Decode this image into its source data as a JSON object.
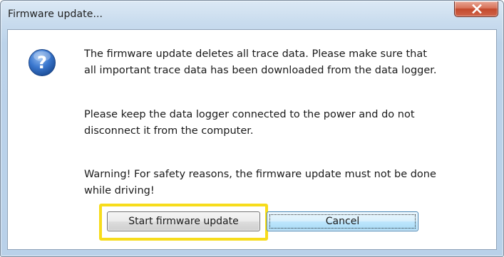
{
  "window": {
    "title": "Firmware update...",
    "close_icon": "close-x-icon"
  },
  "dialog": {
    "icon": "question-icon",
    "paragraphs": [
      {
        "lines": [
          "The firmware update deletes all trace data. Please make sure that",
          "all important trace data has been downloaded from the data logger."
        ]
      },
      {
        "lines": [
          "Please keep the data logger connected to the power and do not",
          "disconnect it from the computer."
        ]
      },
      {
        "lines": [
          "Warning! For safety reasons, the firmware update must not be done",
          "while driving!"
        ]
      }
    ]
  },
  "buttons": {
    "start_label": "Start firmware update",
    "cancel_label": "Cancel"
  },
  "colors": {
    "highlight": "#f7dc1b",
    "close_button": "#c34a2d",
    "question_icon": "#2f6bc0"
  }
}
